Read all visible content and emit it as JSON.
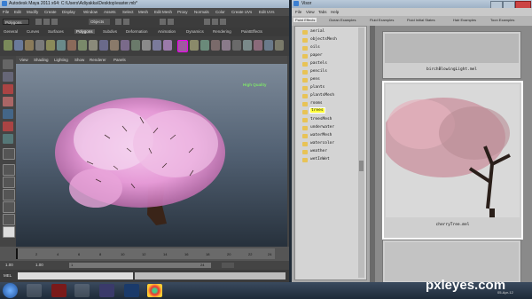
{
  "maya": {
    "title": "Autodesk Maya 2011 x64: C:\\Users\\Adiyakka\\Desktop\\easter.mb*",
    "menu": [
      "File",
      "Edit",
      "Modify",
      "Create",
      "Display",
      "Window",
      "Assets",
      "Select",
      "Mesh",
      "Edit Mesh",
      "Proxy",
      "Normals",
      "Color",
      "Create UVs",
      "Edit UVs",
      "Muscle",
      "Pipeline Cache",
      "Help"
    ],
    "mode": "Polygons",
    "objects_label": "Objects",
    "shelf_tabs": [
      "General",
      "Curves",
      "Surfaces",
      "Polygons",
      "Subdivs",
      "Deformation",
      "Animation",
      "Dynamics",
      "Rendering",
      "PaintEffects"
    ],
    "active_shelf": "Polygons",
    "viewport_menu": [
      "View",
      "Shading",
      "Lighting",
      "Show",
      "Renderer",
      "Panels"
    ],
    "hq_label": "High Quality",
    "range_start": "1.00",
    "range_current": "1.00",
    "range_mid": "1",
    "range_end": "24",
    "cmd_label": "MEL",
    "time_ticks": [
      "2",
      "4",
      "6",
      "8",
      "10",
      "12",
      "14",
      "16",
      "18",
      "20",
      "22",
      "24"
    ]
  },
  "visor": {
    "title": "Visor",
    "menu": [
      "File",
      "View",
      "Tabs",
      "Help"
    ],
    "tabs": [
      "Paint Effects",
      "Ocean Examples",
      "Fluid Examples",
      "Fluid Initial States",
      "Hair Examples",
      "Toon Examples"
    ],
    "active_tab": "Paint Effects",
    "folders": [
      "aerial",
      "objectsMesh",
      "oils",
      "paper",
      "pastels",
      "pencils",
      "pens",
      "plants",
      "plantsMesh",
      "rooms",
      "trees",
      "treesMesh",
      "underwater",
      "waterMesh",
      "watercolor",
      "weather",
      "wetInWet"
    ],
    "selected_folder": "trees",
    "previews": [
      "birchBlowingLight.mel",
      "cherryTree.mel"
    ]
  },
  "taskbar": {
    "apps": [
      "start-orb",
      "maya-app",
      "media-app",
      "zbrush-app",
      "after-effects-app",
      "photoshop-app",
      "chrome-app"
    ],
    "watermark": "pxleyes.com",
    "date": "05-Apr-12"
  }
}
